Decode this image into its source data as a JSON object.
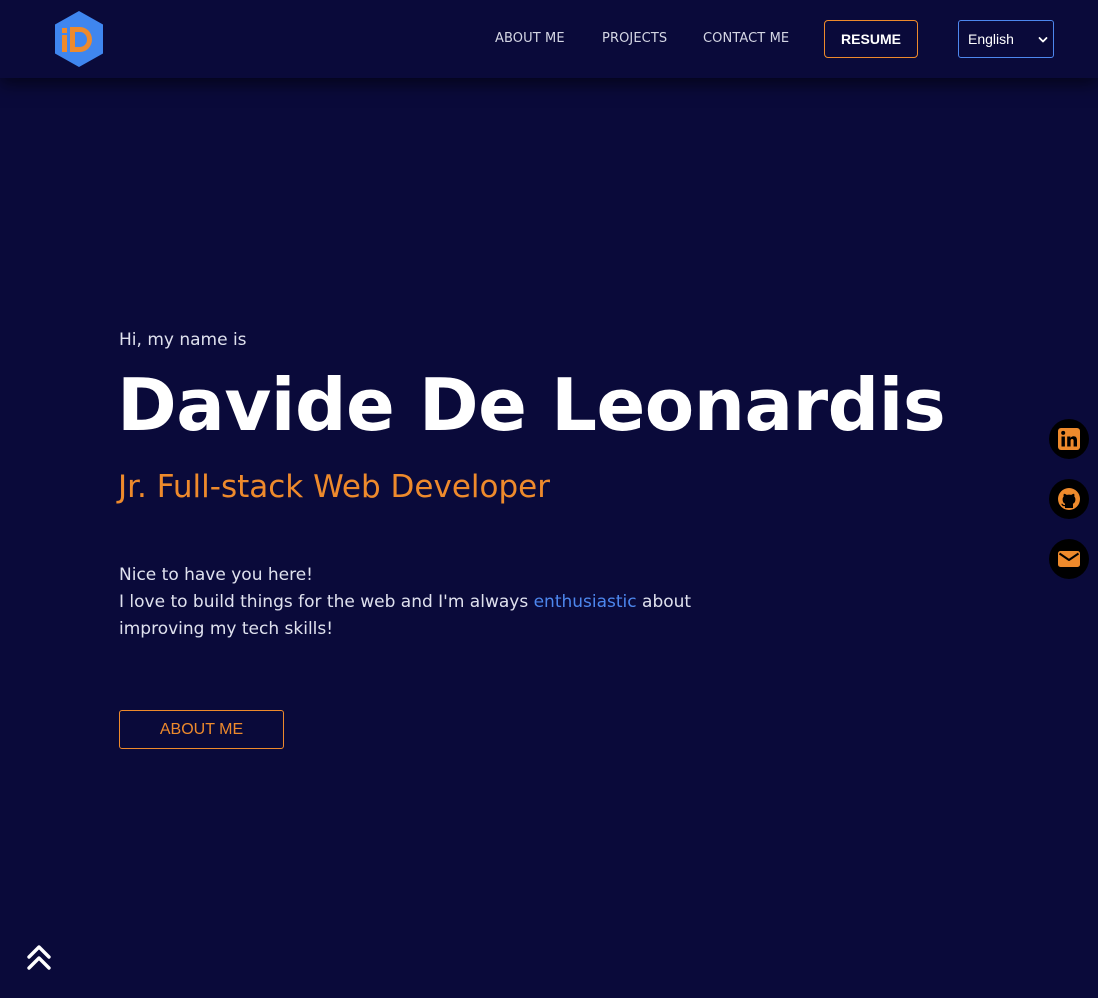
{
  "header": {
    "logo_icon": "hexagon-letter-d-logo-icon",
    "nav": [
      {
        "label": "ABOUT ME"
      },
      {
        "label": "PROJECTS"
      },
      {
        "label": "CONTACT ME"
      }
    ],
    "resume_label": "RESUME",
    "language": {
      "selected": "English",
      "icon": "chevron-down-icon"
    }
  },
  "hero": {
    "greeting": "Hi, my name is",
    "name": "Davide De Leonardis",
    "role": "Jr. Full-stack Web Developer",
    "intro_line1": "Nice to have you here!",
    "intro_line2_before": "I love to build things for the web and I'm always ",
    "intro_highlight": "enthusiastic",
    "intro_line2_after": " about improving my tech skills!",
    "cta_label": "ABOUT ME"
  },
  "social": [
    {
      "name": "linkedin",
      "icon": "linkedin-icon"
    },
    {
      "name": "github",
      "icon": "github-icon"
    },
    {
      "name": "email",
      "icon": "envelope-icon"
    }
  ],
  "back_to_top_icon": "double-chevron-up-icon",
  "colors": {
    "background": "#0a0a3a",
    "accent_orange": "#ee8a2c",
    "accent_blue": "#4d87ee",
    "text": "#dfe1ee"
  }
}
